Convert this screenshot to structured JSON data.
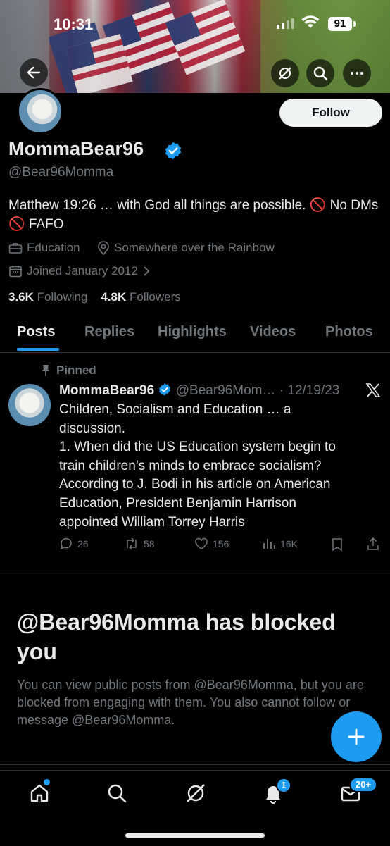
{
  "status_bar": {
    "time": "10:31",
    "battery": "91"
  },
  "profile": {
    "display_name": "MommaBear96",
    "handle": "@Bear96Momma",
    "follow_label": "Follow",
    "bio": "Matthew 19:26 … with God all things are possible. 🚫 No DMs 🚫 FAFO",
    "category": "Education",
    "location": "Somewhere over the Rainbow",
    "joined": "Joined January 2012",
    "following_count": "3.6K",
    "following_label": "Following",
    "followers_count": "4.8K",
    "followers_label": "Followers"
  },
  "tabs": [
    {
      "label": "Posts",
      "active": true
    },
    {
      "label": "Replies"
    },
    {
      "label": "Highlights"
    },
    {
      "label": "Videos"
    },
    {
      "label": "Photos"
    }
  ],
  "pinned_post": {
    "pinned_label": "Pinned",
    "author": "MommaBear96",
    "handle_date": "@Bear96Mom… · 12/19/23",
    "text_lines": [
      "Children, Socialism and Education … a",
      "discussion.",
      "1. When did the US Education system begin to",
      "train children’s minds to embrace socialism?",
      "According to J. Bodi in his article on American",
      "Education, President Benjamin Harrison",
      "appointed William Torrey Harris"
    ],
    "replies": "26",
    "reposts": "58",
    "likes": "156",
    "views": "16K"
  },
  "blocked": {
    "title": "@Bear96Momma has blocked you",
    "message": "You can view public posts from @Bear96Momma, but you are blocked from engaging with them. You also cannot follow or message @Bear96Momma."
  },
  "bottom_nav": {
    "notifications_badge": "1",
    "messages_badge": "20+"
  },
  "colors": {
    "accent": "#1d9bf0",
    "background": "#000000",
    "muted": "#71767b"
  }
}
